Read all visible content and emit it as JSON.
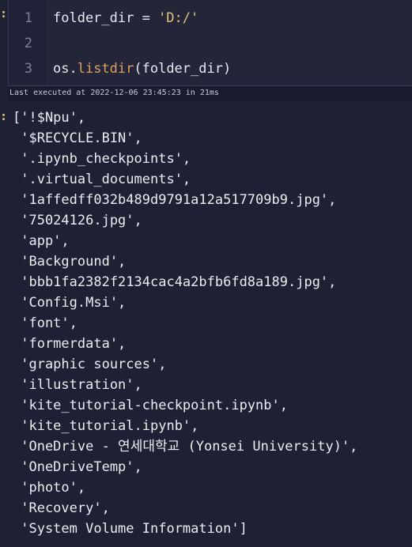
{
  "input_cell": {
    "prompt_marker": ":",
    "lines": [
      {
        "number": "1",
        "text": "folder_dir = ",
        "string": "'D:/'"
      },
      {
        "number": "2",
        "text": ""
      },
      {
        "number": "3",
        "prefix": "os.",
        "function": "listdir",
        "suffix": "(folder_dir)"
      }
    ]
  },
  "execution_info": "Last executed at 2022-12-06 23:45:23 in 21ms",
  "output_cell": {
    "prompt_marker": ":",
    "lines": [
      "['!$Npu',",
      " '$RECYCLE.BIN',",
      " '.ipynb_checkpoints',",
      " '.virtual_documents',",
      " '1affedff032b489d9791a12a517709b9.jpg',",
      " '75024126.jpg',",
      " 'app',",
      " 'Background',",
      " 'bbb1fa2382f2134cac4a2bfb6fd8a189.jpg',",
      " 'Config.Msi',",
      " 'font',",
      " 'formerdata',",
      " 'graphic sources',",
      " 'illustration',",
      " 'kite_tutorial-checkpoint.ipynb',",
      " 'kite_tutorial.ipynb',",
      " 'OneDrive - 연세대학교 (Yonsei University)',",
      " 'OneDriveTemp',",
      " 'photo',",
      " 'Recovery',",
      " 'System Volume Information']"
    ]
  }
}
